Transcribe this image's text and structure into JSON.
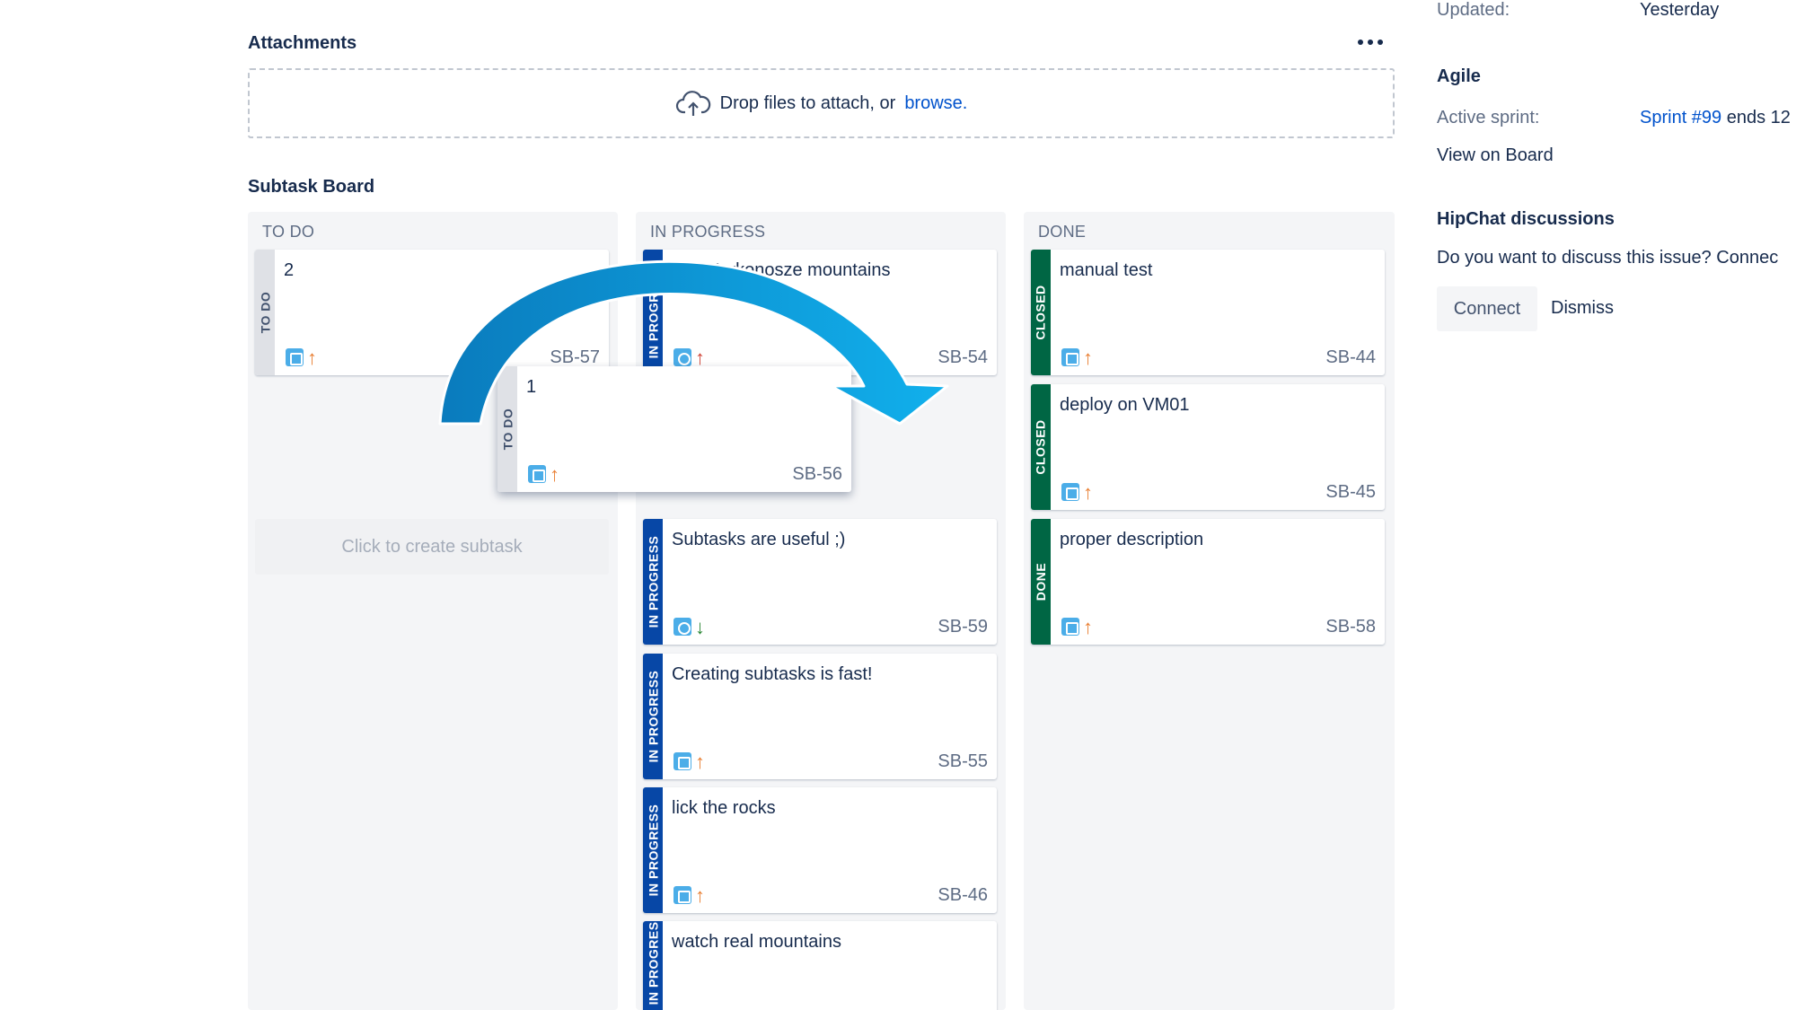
{
  "attachments": {
    "title": "Attachments",
    "drop_text": "Drop files to attach, or",
    "browse_link": "browse."
  },
  "subtask_board": {
    "title": "Subtask Board",
    "create_placeholder": "Click to create subtask",
    "columns": [
      {
        "title": "TO DO"
      },
      {
        "title": "IN PROGRESS"
      },
      {
        "title": "DONE"
      }
    ],
    "cards": [
      {
        "summary": "2",
        "key": "SB-57",
        "status": "TO DO",
        "priority": "↑"
      },
      {
        "summary": "1",
        "key": "SB-56",
        "status": "TO DO",
        "priority": "↑"
      },
      {
        "summary": "visit Karkonosze mountains",
        "key": "SB-54",
        "status": "IN PROGRESS",
        "priority": "↑"
      },
      {
        "summary": "Subtasks are useful ;)",
        "key": "SB-59",
        "status": "IN PROGRESS",
        "priority": "↓"
      },
      {
        "summary": "Creating subtasks is fast!",
        "key": "SB-55",
        "status": "IN PROGRESS",
        "priority": "↑"
      },
      {
        "summary": "lick the rocks",
        "key": "SB-46",
        "status": "IN PROGRESS",
        "priority": "↑"
      },
      {
        "summary": "watch real mountains",
        "key": "",
        "status": "IN PROGRESS",
        "priority": ""
      },
      {
        "summary": "manual test",
        "key": "SB-44",
        "status": "CLOSED",
        "priority": "↑"
      },
      {
        "summary": "deploy on VM01",
        "key": "SB-45",
        "status": "CLOSED",
        "priority": "↑"
      },
      {
        "summary": "proper description",
        "key": "SB-58",
        "status": "DONE",
        "priority": "↑"
      }
    ]
  },
  "sidebar": {
    "updated_label": "Updated:",
    "updated_value": "Yesterday",
    "agile_title": "Agile",
    "active_sprint_label": "Active sprint:",
    "sprint_link": "Sprint #99",
    "sprint_suffix": "ends 12",
    "view_on_board": "View on Board",
    "hipchat_title": "HipChat discussions",
    "hipchat_text": "Do you want to discuss this issue? Connec",
    "connect_button": "Connect",
    "dismiss_link": "Dismiss"
  },
  "colors": {
    "todo_stripe": "#dfe1e6",
    "inprogress_stripe": "#0747a6",
    "done_stripe": "#006644",
    "link": "#0052cc",
    "arrow": "#0a8fd3"
  },
  "icons": [
    "cloud-upload-icon",
    "more-icon",
    "subtask-type-icon",
    "priority-arrow-icon"
  ]
}
